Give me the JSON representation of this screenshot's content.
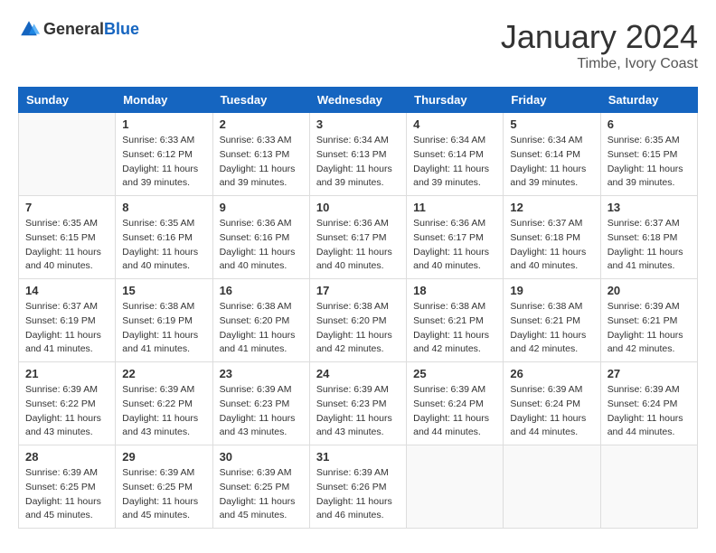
{
  "header": {
    "logo_general": "General",
    "logo_blue": "Blue",
    "month_title": "January 2024",
    "location": "Timbe, Ivory Coast"
  },
  "weekdays": [
    "Sunday",
    "Monday",
    "Tuesday",
    "Wednesday",
    "Thursday",
    "Friday",
    "Saturday"
  ],
  "weeks": [
    [
      {
        "day": "",
        "sunrise": "",
        "sunset": "",
        "daylight": ""
      },
      {
        "day": "1",
        "sunrise": "Sunrise: 6:33 AM",
        "sunset": "Sunset: 6:12 PM",
        "daylight": "Daylight: 11 hours and 39 minutes."
      },
      {
        "day": "2",
        "sunrise": "Sunrise: 6:33 AM",
        "sunset": "Sunset: 6:13 PM",
        "daylight": "Daylight: 11 hours and 39 minutes."
      },
      {
        "day": "3",
        "sunrise": "Sunrise: 6:34 AM",
        "sunset": "Sunset: 6:13 PM",
        "daylight": "Daylight: 11 hours and 39 minutes."
      },
      {
        "day": "4",
        "sunrise": "Sunrise: 6:34 AM",
        "sunset": "Sunset: 6:14 PM",
        "daylight": "Daylight: 11 hours and 39 minutes."
      },
      {
        "day": "5",
        "sunrise": "Sunrise: 6:34 AM",
        "sunset": "Sunset: 6:14 PM",
        "daylight": "Daylight: 11 hours and 39 minutes."
      },
      {
        "day": "6",
        "sunrise": "Sunrise: 6:35 AM",
        "sunset": "Sunset: 6:15 PM",
        "daylight": "Daylight: 11 hours and 39 minutes."
      }
    ],
    [
      {
        "day": "7",
        "sunrise": "Sunrise: 6:35 AM",
        "sunset": "Sunset: 6:15 PM",
        "daylight": "Daylight: 11 hours and 40 minutes."
      },
      {
        "day": "8",
        "sunrise": "Sunrise: 6:35 AM",
        "sunset": "Sunset: 6:16 PM",
        "daylight": "Daylight: 11 hours and 40 minutes."
      },
      {
        "day": "9",
        "sunrise": "Sunrise: 6:36 AM",
        "sunset": "Sunset: 6:16 PM",
        "daylight": "Daylight: 11 hours and 40 minutes."
      },
      {
        "day": "10",
        "sunrise": "Sunrise: 6:36 AM",
        "sunset": "Sunset: 6:17 PM",
        "daylight": "Daylight: 11 hours and 40 minutes."
      },
      {
        "day": "11",
        "sunrise": "Sunrise: 6:36 AM",
        "sunset": "Sunset: 6:17 PM",
        "daylight": "Daylight: 11 hours and 40 minutes."
      },
      {
        "day": "12",
        "sunrise": "Sunrise: 6:37 AM",
        "sunset": "Sunset: 6:18 PM",
        "daylight": "Daylight: 11 hours and 40 minutes."
      },
      {
        "day": "13",
        "sunrise": "Sunrise: 6:37 AM",
        "sunset": "Sunset: 6:18 PM",
        "daylight": "Daylight: 11 hours and 41 minutes."
      }
    ],
    [
      {
        "day": "14",
        "sunrise": "Sunrise: 6:37 AM",
        "sunset": "Sunset: 6:19 PM",
        "daylight": "Daylight: 11 hours and 41 minutes."
      },
      {
        "day": "15",
        "sunrise": "Sunrise: 6:38 AM",
        "sunset": "Sunset: 6:19 PM",
        "daylight": "Daylight: 11 hours and 41 minutes."
      },
      {
        "day": "16",
        "sunrise": "Sunrise: 6:38 AM",
        "sunset": "Sunset: 6:20 PM",
        "daylight": "Daylight: 11 hours and 41 minutes."
      },
      {
        "day": "17",
        "sunrise": "Sunrise: 6:38 AM",
        "sunset": "Sunset: 6:20 PM",
        "daylight": "Daylight: 11 hours and 42 minutes."
      },
      {
        "day": "18",
        "sunrise": "Sunrise: 6:38 AM",
        "sunset": "Sunset: 6:21 PM",
        "daylight": "Daylight: 11 hours and 42 minutes."
      },
      {
        "day": "19",
        "sunrise": "Sunrise: 6:38 AM",
        "sunset": "Sunset: 6:21 PM",
        "daylight": "Daylight: 11 hours and 42 minutes."
      },
      {
        "day": "20",
        "sunrise": "Sunrise: 6:39 AM",
        "sunset": "Sunset: 6:21 PM",
        "daylight": "Daylight: 11 hours and 42 minutes."
      }
    ],
    [
      {
        "day": "21",
        "sunrise": "Sunrise: 6:39 AM",
        "sunset": "Sunset: 6:22 PM",
        "daylight": "Daylight: 11 hours and 43 minutes."
      },
      {
        "day": "22",
        "sunrise": "Sunrise: 6:39 AM",
        "sunset": "Sunset: 6:22 PM",
        "daylight": "Daylight: 11 hours and 43 minutes."
      },
      {
        "day": "23",
        "sunrise": "Sunrise: 6:39 AM",
        "sunset": "Sunset: 6:23 PM",
        "daylight": "Daylight: 11 hours and 43 minutes."
      },
      {
        "day": "24",
        "sunrise": "Sunrise: 6:39 AM",
        "sunset": "Sunset: 6:23 PM",
        "daylight": "Daylight: 11 hours and 43 minutes."
      },
      {
        "day": "25",
        "sunrise": "Sunrise: 6:39 AM",
        "sunset": "Sunset: 6:24 PM",
        "daylight": "Daylight: 11 hours and 44 minutes."
      },
      {
        "day": "26",
        "sunrise": "Sunrise: 6:39 AM",
        "sunset": "Sunset: 6:24 PM",
        "daylight": "Daylight: 11 hours and 44 minutes."
      },
      {
        "day": "27",
        "sunrise": "Sunrise: 6:39 AM",
        "sunset": "Sunset: 6:24 PM",
        "daylight": "Daylight: 11 hours and 44 minutes."
      }
    ],
    [
      {
        "day": "28",
        "sunrise": "Sunrise: 6:39 AM",
        "sunset": "Sunset: 6:25 PM",
        "daylight": "Daylight: 11 hours and 45 minutes."
      },
      {
        "day": "29",
        "sunrise": "Sunrise: 6:39 AM",
        "sunset": "Sunset: 6:25 PM",
        "daylight": "Daylight: 11 hours and 45 minutes."
      },
      {
        "day": "30",
        "sunrise": "Sunrise: 6:39 AM",
        "sunset": "Sunset: 6:25 PM",
        "daylight": "Daylight: 11 hours and 45 minutes."
      },
      {
        "day": "31",
        "sunrise": "Sunrise: 6:39 AM",
        "sunset": "Sunset: 6:26 PM",
        "daylight": "Daylight: 11 hours and 46 minutes."
      },
      {
        "day": "",
        "sunrise": "",
        "sunset": "",
        "daylight": ""
      },
      {
        "day": "",
        "sunrise": "",
        "sunset": "",
        "daylight": ""
      },
      {
        "day": "",
        "sunrise": "",
        "sunset": "",
        "daylight": ""
      }
    ]
  ]
}
